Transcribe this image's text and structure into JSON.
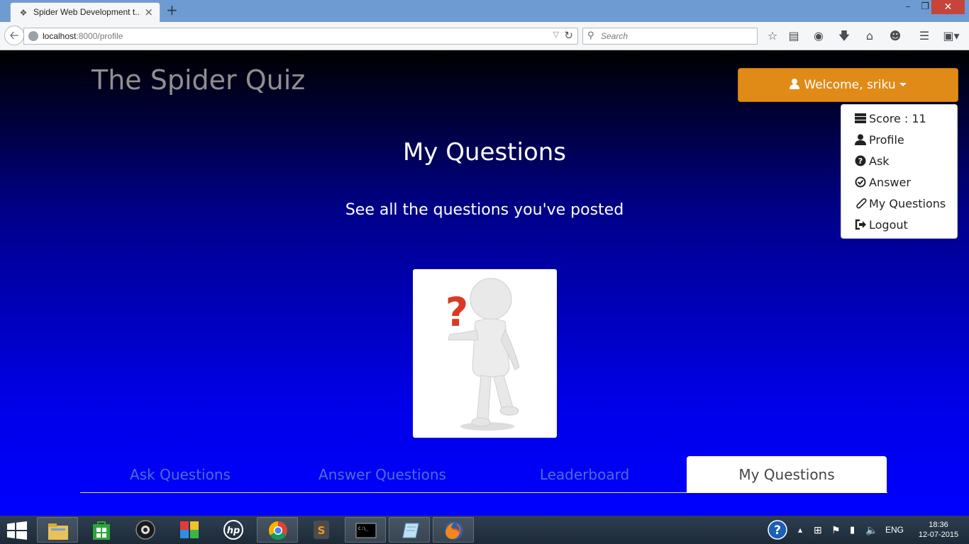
{
  "browser": {
    "tab_title": "Spider Web Development t...",
    "url_host": "localhost",
    "url_rest": ":8000/profile",
    "search_placeholder": "Search"
  },
  "header": {
    "brand": "The Spider Quiz",
    "welcome_label": "Welcome, sriku"
  },
  "dropdown": {
    "items": [
      {
        "label": "Score : 11",
        "icon": "tasks-icon"
      },
      {
        "label": "Profile",
        "icon": "user-icon"
      },
      {
        "label": "Ask",
        "icon": "question-circle-icon"
      },
      {
        "label": "Answer",
        "icon": "check-circle-icon"
      },
      {
        "label": "My Questions",
        "icon": "paperclip-icon"
      },
      {
        "label": "Logout",
        "icon": "logout-icon"
      }
    ]
  },
  "main": {
    "title": "My Questions",
    "subtitle": "See all the questions you've posted"
  },
  "tabs": [
    {
      "label": "Ask Questions",
      "active": false
    },
    {
      "label": "Answer Questions",
      "active": false
    },
    {
      "label": "Leaderboard",
      "active": false
    },
    {
      "label": "My Questions",
      "active": true
    }
  ],
  "taskbar": {
    "language": "ENG",
    "time": "18:36",
    "date": "12-07-2015",
    "apps": [
      "file-explorer-icon",
      "store-icon",
      "camera-icon",
      "photo-app-icon",
      "hp-icon",
      "chrome-icon",
      "sublime-icon",
      "cmd-icon",
      "notepad-icon",
      "firefox-icon"
    ]
  },
  "colors": {
    "accent_orange": "#e08a18",
    "tab_link": "#4b6fd8",
    "page_blue": "#0000ff"
  }
}
